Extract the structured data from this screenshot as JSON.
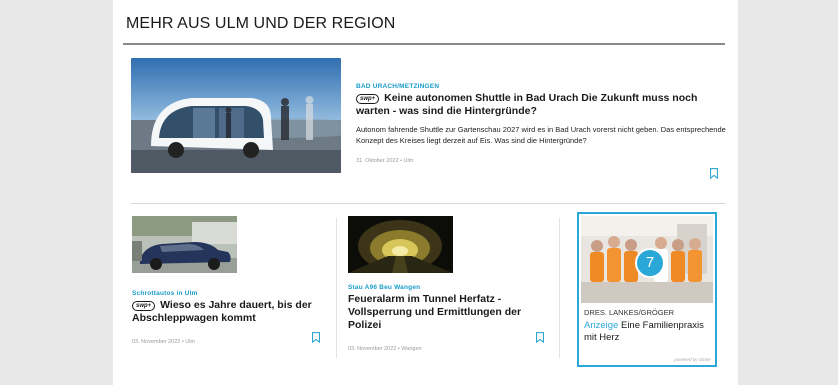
{
  "section": {
    "title": "MEHR AUS ULM UND DER REGION"
  },
  "lead": {
    "kicker": "BAD URACH/METZINGEN",
    "badge": "swp+",
    "headline": "Keine autonomen Shuttle in Bad Urach Die Zukunft muss noch warten - was sind die Hintergründe?",
    "teaser": "Autonom fahrende Shuttle zur Gartenschau 2027 wird es in Bad Urach vorerst nicht geben. Das entsprechende Konzept des Kreises liegt derzeit auf Eis. Was sind die Hintergründe?",
    "meta": "31. Oktober 2022 • Ulm"
  },
  "cards": [
    {
      "kicker": "Schrottautos in Ulm",
      "badge": "swp+",
      "headline": "Wieso es Jahre dauert, bis der Abschleppwagen kommt",
      "meta": "03. November 2022 • Ulm"
    },
    {
      "kicker": "Stau A96 Beu Wangen",
      "headline": "Feueralarm im Tunnel Herfatz - Vollsperrung und Ermittlungen der Polizei",
      "meta": "03. November 2022 • Wangen"
    }
  ],
  "ad": {
    "badge_number": "7",
    "brand": "DRES. LANKES/GRÖGER",
    "label": "Anzeige",
    "text": "Eine Familienpraxis mit Herz",
    "footer": "powered by Ströer"
  },
  "colors": {
    "accent": "#1a9cc9",
    "ad_border": "#29a8d8",
    "background": "#e8e8e8"
  },
  "icons": [
    "bookmark-icon"
  ]
}
